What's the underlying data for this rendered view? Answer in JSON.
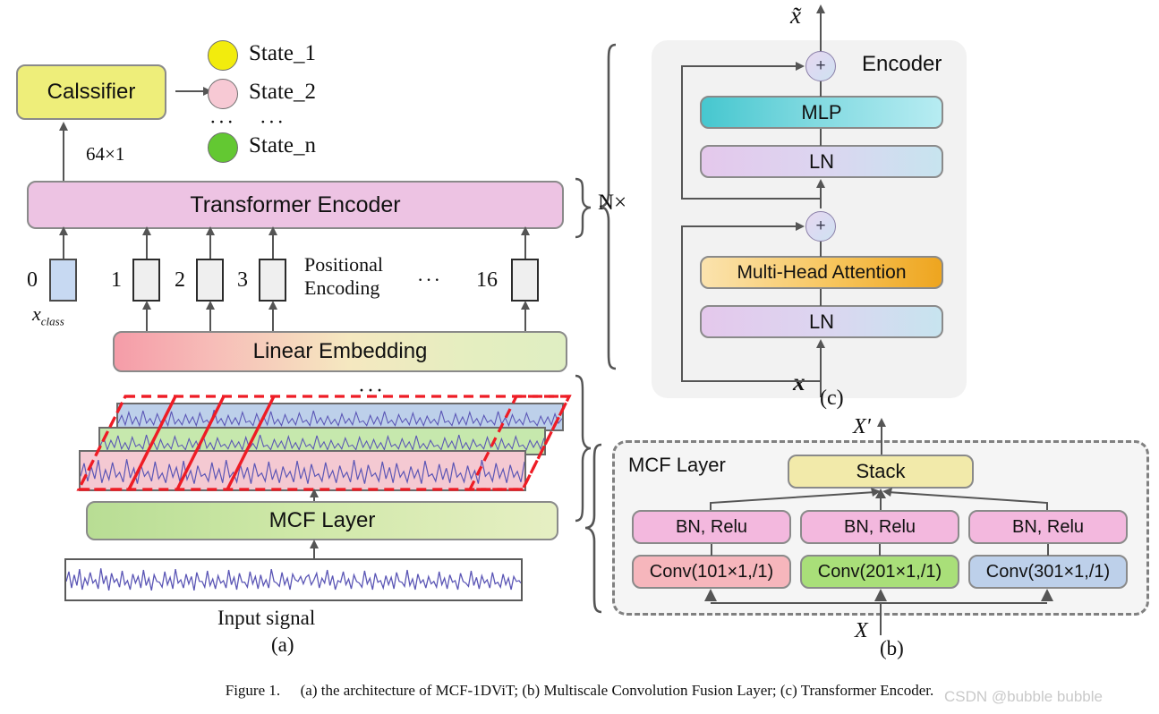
{
  "figure": {
    "caption_prefix": "Figure 1.",
    "caption_text": "(a) the architecture of MCF-1DViT; (b) Multiscale Convolution Fusion Layer; (c) Transformer Encoder.",
    "watermark": "CSDN @bubble bubble"
  },
  "panel_a": {
    "label": "(a)",
    "classifier": {
      "label": "Calssifier",
      "color": "#eeee7a"
    },
    "classifier_arrow_label": "64×1",
    "states": [
      {
        "label": "State_1",
        "color": "#f2ec0d"
      },
      {
        "label": "State_2",
        "color": "#f7c9d4"
      },
      {
        "label": "State_n",
        "color": "#63c832"
      }
    ],
    "states_ellipsis_left": "···",
    "states_ellipsis_right": "···",
    "transformer_encoder": {
      "label": "Transformer Encoder",
      "color": "#edc3e3"
    },
    "positional_encoding_label_line1": "Positional",
    "positional_encoding_label_line2": "Encoding",
    "tokens": [
      {
        "index": "0",
        "color": "#c7d9f2",
        "class_token": true
      },
      {
        "index": "1",
        "color": "#efefef",
        "class_token": false
      },
      {
        "index": "2",
        "color": "#efefef",
        "class_token": false
      },
      {
        "index": "3",
        "color": "#efefef",
        "class_token": false
      },
      {
        "index": "16",
        "color": "#efefef",
        "class_token": false
      }
    ],
    "tokens_ellipsis": "···",
    "x_class_label": "x",
    "x_class_sub": "class",
    "linear_embedding": {
      "label": "Linear Embedding"
    },
    "bands_ellipsis": "···",
    "signal_bands": [
      {
        "name": "band-blue",
        "color": "#bdd0ea"
      },
      {
        "name": "band-green",
        "color": "#c6e8ad"
      },
      {
        "name": "band-pink",
        "color": "#f4c9d2"
      }
    ],
    "mcf_layer": {
      "label": "MCF Layer"
    },
    "input_signal": {
      "label": "Input signal"
    },
    "signal_color": "#5a55b5",
    "selection_color": "#ee1c25"
  },
  "panel_c": {
    "label": "(c)",
    "title": "Encoder",
    "repeat_label": "N×",
    "output_symbol": "x̃",
    "input_symbol": "x",
    "blocks": [
      {
        "name": "mlp",
        "label": "MLP"
      },
      {
        "name": "ln-top",
        "label": "LN"
      },
      {
        "name": "mha",
        "label": "Multi-Head Attention"
      },
      {
        "name": "ln-bottom",
        "label": "LN"
      }
    ],
    "residual_symbol": "+"
  },
  "panel_b": {
    "label": "(b)",
    "title": "MCF Layer",
    "output_symbol": "X′",
    "input_symbol": "X",
    "stack": {
      "label": "Stack",
      "color": "#f2eaaa"
    },
    "branches": [
      {
        "bn_label": "BN, Relu",
        "conv_label": "Conv(101×1,/1)",
        "conv_color": "#f6b6bc"
      },
      {
        "bn_label": "BN, Relu",
        "conv_label": "Conv(201×1,/1)",
        "conv_color": "#a9df79"
      },
      {
        "bn_label": "BN, Relu",
        "conv_label": "Conv(301×1,/1)",
        "conv_color": "#bdd0ea"
      }
    ],
    "bn_color": "#f3b8de"
  }
}
